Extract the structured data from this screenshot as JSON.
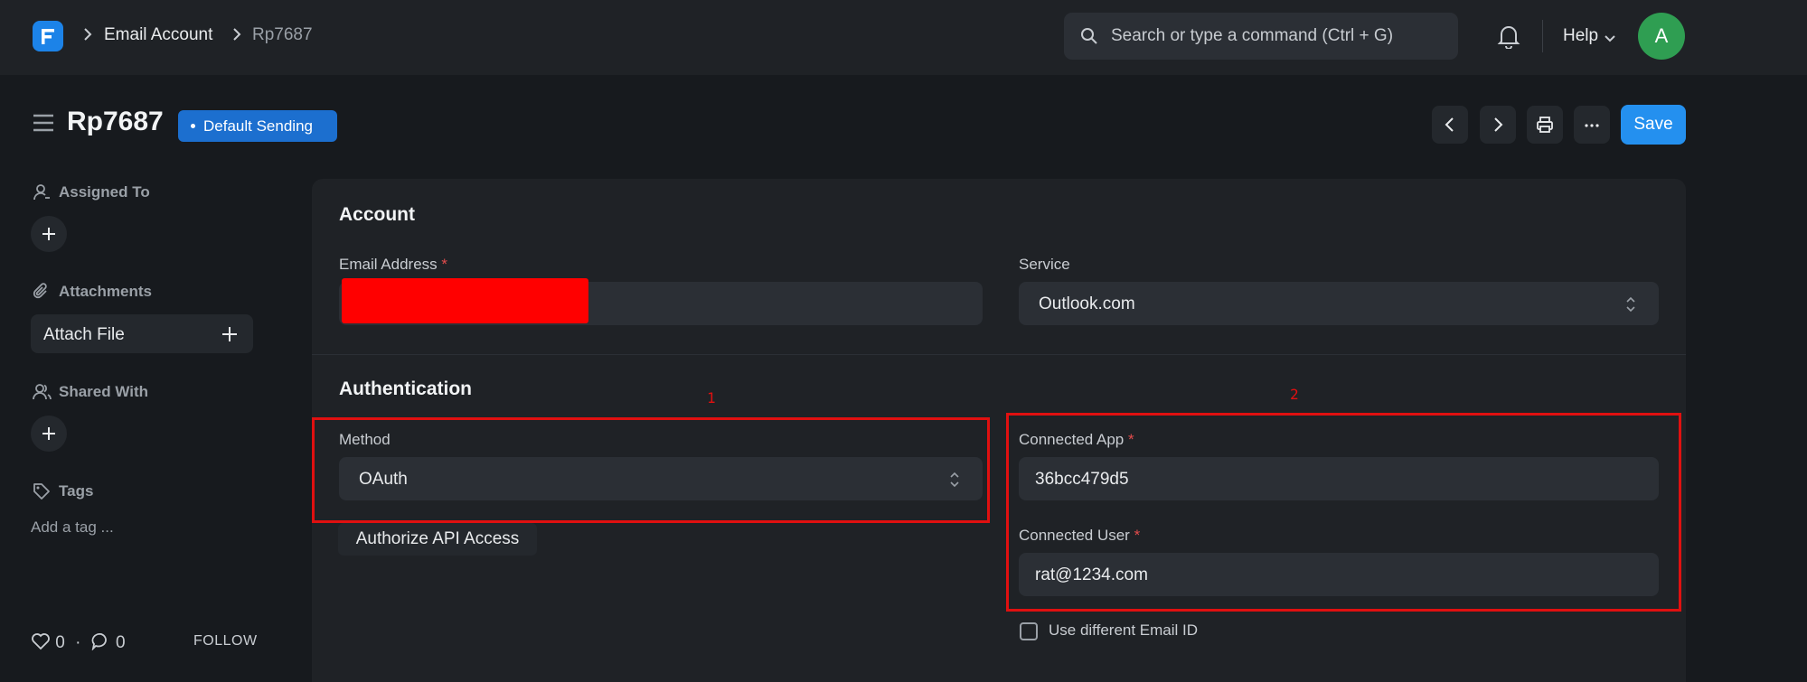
{
  "navbar": {
    "breadcrumbs": [
      "Email Account",
      "Rp7687"
    ],
    "search_placeholder": "Search or type a command (Ctrl + G)",
    "help_label": "Help",
    "avatar_initial": "A"
  },
  "page": {
    "title": "Rp7687",
    "status_badge": "Default Sending",
    "save_label": "Save"
  },
  "sidebar": {
    "assigned_to": "Assigned To",
    "attachments": "Attachments",
    "attach_file": "Attach File",
    "shared_with": "Shared With",
    "tags": "Tags",
    "add_tag_placeholder": "Add a tag ...",
    "likes": "0",
    "comments": "0",
    "follow": "FOLLOW"
  },
  "form": {
    "account_section": "Account",
    "email_label": "Email Address",
    "service_label": "Service",
    "service_value": "Outlook.com",
    "authentication_section": "Authentication",
    "method_label": "Method",
    "method_value": "OAuth",
    "authorize_button": "Authorize API Access",
    "connected_app_label": "Connected App",
    "connected_app_value": "36bcc479d5",
    "connected_user_label": "Connected User",
    "connected_user_value": "rat@1234.com",
    "use_different_email": "Use different Email ID"
  },
  "annotations": [
    "1",
    "2"
  ],
  "colors": {
    "accent": "#2490ef",
    "badge": "#1c6fcf",
    "avatar": "#2f9e52",
    "annotation": "#e01010",
    "redaction": "#ff0000"
  }
}
